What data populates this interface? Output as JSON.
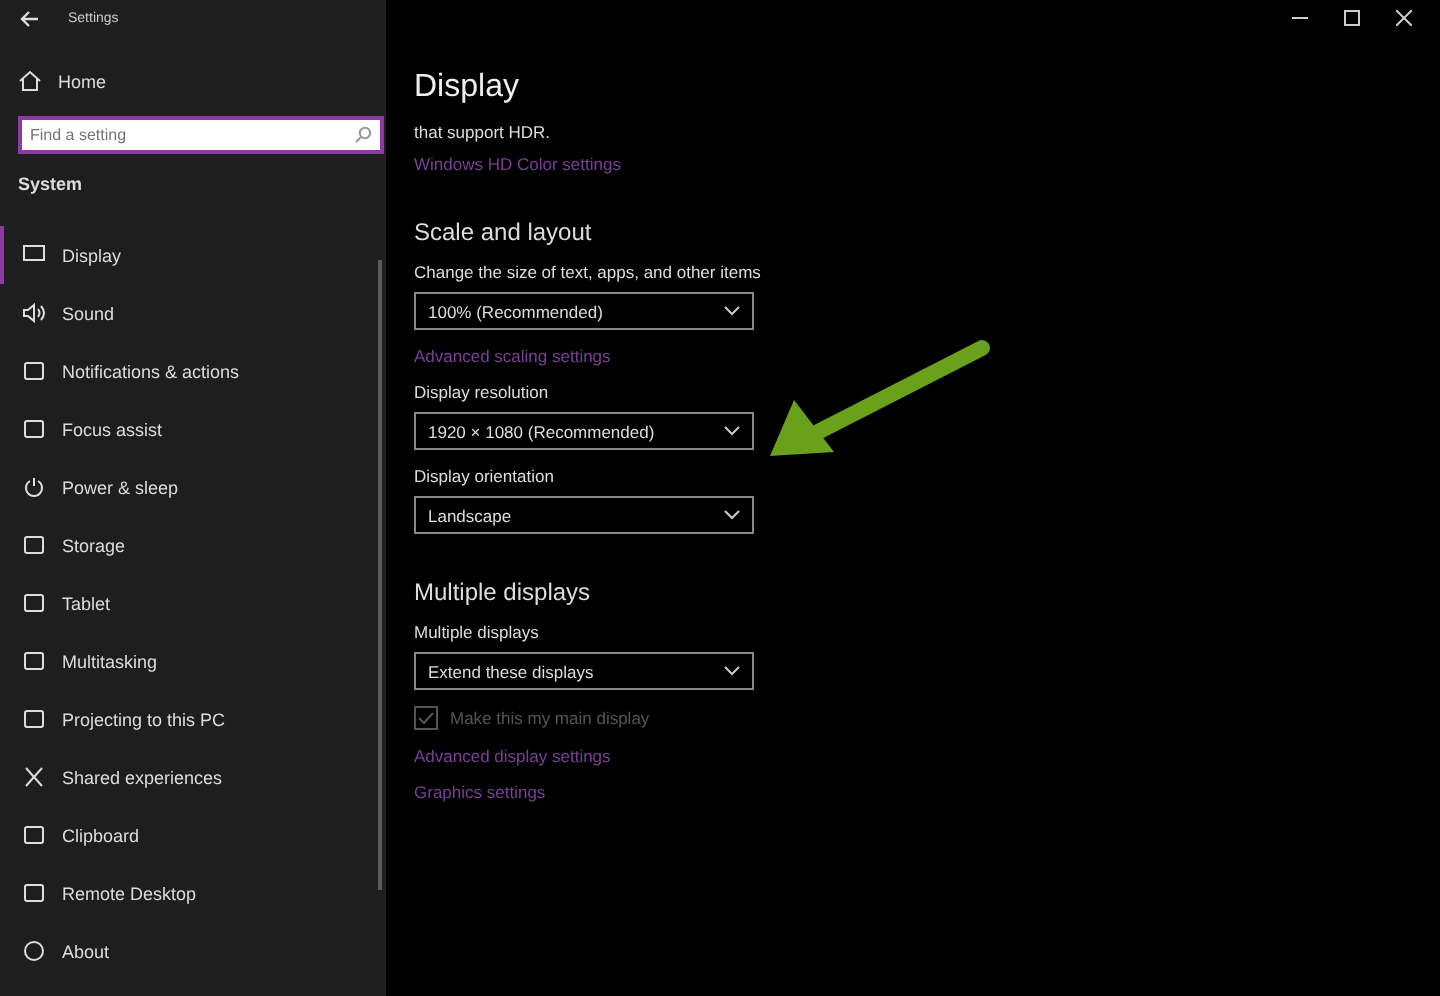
{
  "window": {
    "title": "Settings"
  },
  "sidebar": {
    "home": "Home",
    "search": {
      "placeholder": "Find a setting"
    },
    "section": "System",
    "items": [
      {
        "label": "Display",
        "selected": true
      },
      {
        "label": "Sound",
        "selected": false
      },
      {
        "label": "Notifications & actions",
        "selected": false
      },
      {
        "label": "Focus assist",
        "selected": false
      },
      {
        "label": "Power & sleep",
        "selected": false
      },
      {
        "label": "Storage",
        "selected": false
      },
      {
        "label": "Tablet",
        "selected": false
      },
      {
        "label": "Multitasking",
        "selected": false
      },
      {
        "label": "Projecting to this PC",
        "selected": false
      },
      {
        "label": "Shared experiences",
        "selected": false
      },
      {
        "label": "Clipboard",
        "selected": false
      },
      {
        "label": "Remote Desktop",
        "selected": false
      },
      {
        "label": "About",
        "selected": false
      }
    ]
  },
  "page": {
    "title": "Display",
    "hdr_text": "that support HDR.",
    "hdr_link": "Windows HD Color settings",
    "sections": [
      {
        "heading": "Scale and layout",
        "items": [
          {
            "kind": "dropdown",
            "label": "Change the size of text, apps, and other items",
            "value": "100% (Recommended)"
          },
          {
            "kind": "link",
            "label": "Advanced scaling settings"
          },
          {
            "kind": "dropdown",
            "label": "Display resolution",
            "value": "1920 × 1080 (Recommended)"
          },
          {
            "kind": "dropdown",
            "label": "Display orientation",
            "value": "Landscape"
          }
        ]
      },
      {
        "heading": "Multiple displays",
        "items": [
          {
            "kind": "dropdown",
            "label": "Multiple displays",
            "value": "Extend these displays"
          },
          {
            "kind": "checkbox",
            "label": "Make this my main display",
            "checked": true,
            "disabled": true
          },
          {
            "kind": "link",
            "label": "Advanced display settings"
          },
          {
            "kind": "link",
            "label": "Graphics settings"
          }
        ]
      }
    ]
  }
}
